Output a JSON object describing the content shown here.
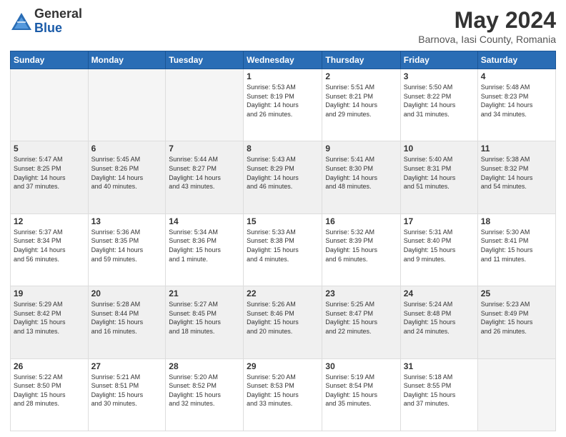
{
  "header": {
    "logo_general": "General",
    "logo_blue": "Blue",
    "month_title": "May 2024",
    "location": "Barnova, Iasi County, Romania"
  },
  "days_of_week": [
    "Sunday",
    "Monday",
    "Tuesday",
    "Wednesday",
    "Thursday",
    "Friday",
    "Saturday"
  ],
  "weeks": [
    [
      {
        "day": "",
        "info": ""
      },
      {
        "day": "",
        "info": ""
      },
      {
        "day": "",
        "info": ""
      },
      {
        "day": "1",
        "info": "Sunrise: 5:53 AM\nSunset: 8:19 PM\nDaylight: 14 hours\nand 26 minutes."
      },
      {
        "day": "2",
        "info": "Sunrise: 5:51 AM\nSunset: 8:21 PM\nDaylight: 14 hours\nand 29 minutes."
      },
      {
        "day": "3",
        "info": "Sunrise: 5:50 AM\nSunset: 8:22 PM\nDaylight: 14 hours\nand 31 minutes."
      },
      {
        "day": "4",
        "info": "Sunrise: 5:48 AM\nSunset: 8:23 PM\nDaylight: 14 hours\nand 34 minutes."
      }
    ],
    [
      {
        "day": "5",
        "info": "Sunrise: 5:47 AM\nSunset: 8:25 PM\nDaylight: 14 hours\nand 37 minutes."
      },
      {
        "day": "6",
        "info": "Sunrise: 5:45 AM\nSunset: 8:26 PM\nDaylight: 14 hours\nand 40 minutes."
      },
      {
        "day": "7",
        "info": "Sunrise: 5:44 AM\nSunset: 8:27 PM\nDaylight: 14 hours\nand 43 minutes."
      },
      {
        "day": "8",
        "info": "Sunrise: 5:43 AM\nSunset: 8:29 PM\nDaylight: 14 hours\nand 46 minutes."
      },
      {
        "day": "9",
        "info": "Sunrise: 5:41 AM\nSunset: 8:30 PM\nDaylight: 14 hours\nand 48 minutes."
      },
      {
        "day": "10",
        "info": "Sunrise: 5:40 AM\nSunset: 8:31 PM\nDaylight: 14 hours\nand 51 minutes."
      },
      {
        "day": "11",
        "info": "Sunrise: 5:38 AM\nSunset: 8:32 PM\nDaylight: 14 hours\nand 54 minutes."
      }
    ],
    [
      {
        "day": "12",
        "info": "Sunrise: 5:37 AM\nSunset: 8:34 PM\nDaylight: 14 hours\nand 56 minutes."
      },
      {
        "day": "13",
        "info": "Sunrise: 5:36 AM\nSunset: 8:35 PM\nDaylight: 14 hours\nand 59 minutes."
      },
      {
        "day": "14",
        "info": "Sunrise: 5:34 AM\nSunset: 8:36 PM\nDaylight: 15 hours\nand 1 minute."
      },
      {
        "day": "15",
        "info": "Sunrise: 5:33 AM\nSunset: 8:38 PM\nDaylight: 15 hours\nand 4 minutes."
      },
      {
        "day": "16",
        "info": "Sunrise: 5:32 AM\nSunset: 8:39 PM\nDaylight: 15 hours\nand 6 minutes."
      },
      {
        "day": "17",
        "info": "Sunrise: 5:31 AM\nSunset: 8:40 PM\nDaylight: 15 hours\nand 9 minutes."
      },
      {
        "day": "18",
        "info": "Sunrise: 5:30 AM\nSunset: 8:41 PM\nDaylight: 15 hours\nand 11 minutes."
      }
    ],
    [
      {
        "day": "19",
        "info": "Sunrise: 5:29 AM\nSunset: 8:42 PM\nDaylight: 15 hours\nand 13 minutes."
      },
      {
        "day": "20",
        "info": "Sunrise: 5:28 AM\nSunset: 8:44 PM\nDaylight: 15 hours\nand 16 minutes."
      },
      {
        "day": "21",
        "info": "Sunrise: 5:27 AM\nSunset: 8:45 PM\nDaylight: 15 hours\nand 18 minutes."
      },
      {
        "day": "22",
        "info": "Sunrise: 5:26 AM\nSunset: 8:46 PM\nDaylight: 15 hours\nand 20 minutes."
      },
      {
        "day": "23",
        "info": "Sunrise: 5:25 AM\nSunset: 8:47 PM\nDaylight: 15 hours\nand 22 minutes."
      },
      {
        "day": "24",
        "info": "Sunrise: 5:24 AM\nSunset: 8:48 PM\nDaylight: 15 hours\nand 24 minutes."
      },
      {
        "day": "25",
        "info": "Sunrise: 5:23 AM\nSunset: 8:49 PM\nDaylight: 15 hours\nand 26 minutes."
      }
    ],
    [
      {
        "day": "26",
        "info": "Sunrise: 5:22 AM\nSunset: 8:50 PM\nDaylight: 15 hours\nand 28 minutes."
      },
      {
        "day": "27",
        "info": "Sunrise: 5:21 AM\nSunset: 8:51 PM\nDaylight: 15 hours\nand 30 minutes."
      },
      {
        "day": "28",
        "info": "Sunrise: 5:20 AM\nSunset: 8:52 PM\nDaylight: 15 hours\nand 32 minutes."
      },
      {
        "day": "29",
        "info": "Sunrise: 5:20 AM\nSunset: 8:53 PM\nDaylight: 15 hours\nand 33 minutes."
      },
      {
        "day": "30",
        "info": "Sunrise: 5:19 AM\nSunset: 8:54 PM\nDaylight: 15 hours\nand 35 minutes."
      },
      {
        "day": "31",
        "info": "Sunrise: 5:18 AM\nSunset: 8:55 PM\nDaylight: 15 hours\nand 37 minutes."
      },
      {
        "day": "",
        "info": ""
      }
    ]
  ]
}
